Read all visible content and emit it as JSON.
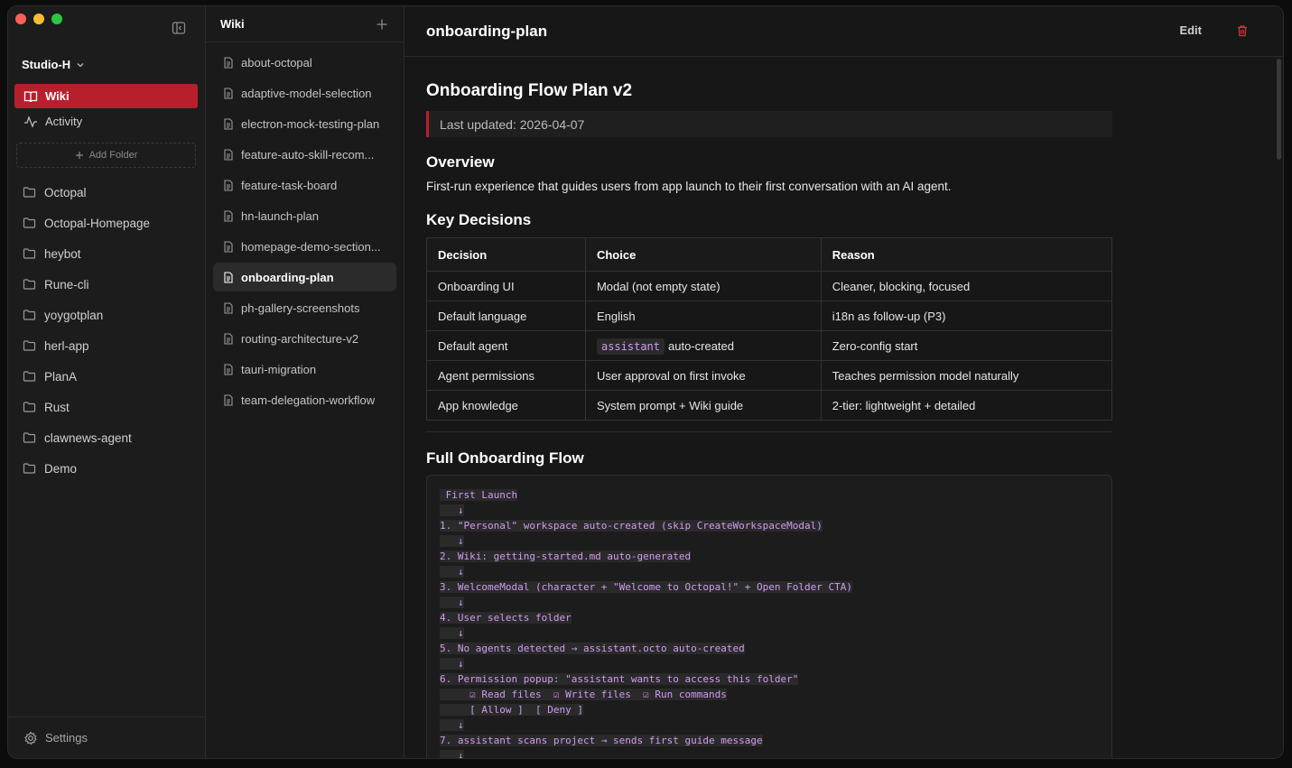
{
  "workspace": {
    "name": "Studio-H"
  },
  "nav": [
    {
      "label": "Wiki",
      "icon": "book-icon",
      "active": true
    },
    {
      "label": "Activity",
      "icon": "activity-icon",
      "active": false
    }
  ],
  "add_folder_label": "Add Folder",
  "folders": [
    "Octopal",
    "Octopal-Homepage",
    "heybot",
    "Rune-cli",
    "yoygotplan",
    "herl-app",
    "PlanA",
    "Rust",
    "clawnews-agent",
    "Demo"
  ],
  "settings_label": "Settings",
  "pagelist": {
    "title": "Wiki",
    "pages": [
      "about-octopal",
      "adaptive-model-selection",
      "electron-mock-testing-plan",
      "feature-auto-skill-recom...",
      "feature-task-board",
      "hn-launch-plan",
      "homepage-demo-section...",
      "onboarding-plan",
      "ph-gallery-screenshots",
      "routing-architecture-v2",
      "tauri-migration",
      "team-delegation-workflow"
    ],
    "active_index": 7
  },
  "main": {
    "title": "onboarding-plan",
    "edit_label": "Edit",
    "doc": {
      "h1": "Onboarding Flow Plan v2",
      "updated": "Last updated: 2026-04-07",
      "overview_heading": "Overview",
      "overview_text": "First-run experience that guides users from app launch to their first conversation with an AI agent.",
      "decisions_heading": "Key Decisions",
      "table_headers": [
        "Decision",
        "Choice",
        "Reason"
      ],
      "table_rows": [
        [
          "Onboarding UI",
          "Modal (not empty state)",
          "Cleaner, blocking, focused"
        ],
        [
          "Default language",
          "English",
          "i18n as follow-up (P3)"
        ],
        [
          "Default agent",
          "auto-created",
          "Zero-config start"
        ],
        [
          "Agent permissions",
          "User approval on first invoke",
          "Teaches permission model naturally"
        ],
        [
          "App knowledge",
          "System prompt + Wiki guide",
          "2-tier: lightweight + detailed"
        ]
      ],
      "inline_code": "assistant",
      "flow_heading": "Full Onboarding Flow",
      "flow_lines": [
        " First Launch",
        "   ↓",
        "1. \"Personal\" workspace auto-created (skip CreateWorkspaceModal)",
        "   ↓",
        "2. Wiki: getting-started.md auto-generated",
        "   ↓",
        "3. WelcomeModal (character + \"Welcome to Octopal!\" + Open Folder CTA)",
        "   ↓",
        "4. User selects folder",
        "   ↓",
        "5. No agents detected → assistant.octo auto-created",
        "   ↓",
        "6. Permission popup: \"assistant wants to access this folder\"",
        "     ☑ Read files  ☑ Write files  ☑ Run commands",
        "     [ Allow ]  [ Deny ]",
        "   ↓",
        "7. assistant scans project → sends first guide message",
        "   ↓"
      ]
    }
  },
  "colors": {
    "accent": "#b81f2c",
    "code": "#d19cf3"
  }
}
